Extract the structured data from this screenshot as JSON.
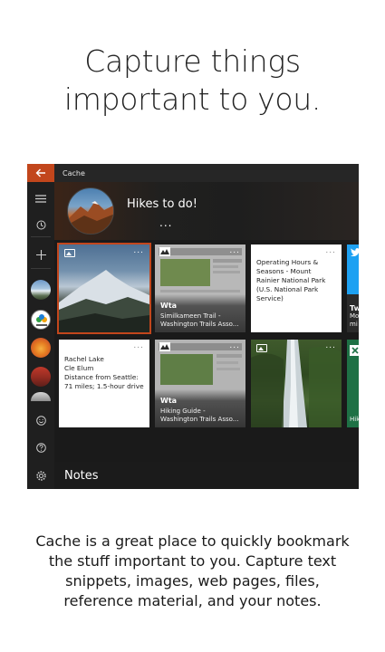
{
  "headline": {
    "line1": "Capture things",
    "line2": "important to you."
  },
  "app": {
    "title": "Cache",
    "back_icon": "back-arrow-icon",
    "accent_color": "#c2461c",
    "sidebar_icons": [
      "hamburger-menu-icon",
      "history-icon",
      "plus-icon",
      "emoji-icon",
      "help-icon",
      "gear-icon"
    ],
    "banner": {
      "title": "Hikes to do!",
      "more": "..."
    },
    "tiles": {
      "t1": {
        "more": "..."
      },
      "t2": {
        "more": "...",
        "site": "Wta",
        "caption": "Similkameen Trail - Washington Trails Asso..."
      },
      "t3": {
        "more": "...",
        "text": "Operating Hours & Seasons - Mount Rainier National Park (U.S. National Park Service)"
      },
      "t4": {
        "site": "Tw",
        "caption": "Mo mi"
      },
      "t5": {
        "more": "...",
        "line1": "Rachel Lake",
        "line2": "Cle Elum",
        "line3": "Distance from Seattle: 71 miles; 1.5-hour drive"
      },
      "t6": {
        "more": "...",
        "site": "Wta",
        "caption": "Hiking Guide - Washington Trails Asso..."
      },
      "t7": {
        "more": "..."
      },
      "t8": {
        "caption": "Hik"
      }
    },
    "notes_label": "Notes"
  },
  "description": {
    "line1": "Cache is a great place to quickly bookmark",
    "line2": "the stuff important to you. Capture text",
    "line3": "snippets, images, web pages, files,",
    "line4": "reference material, and your notes."
  }
}
